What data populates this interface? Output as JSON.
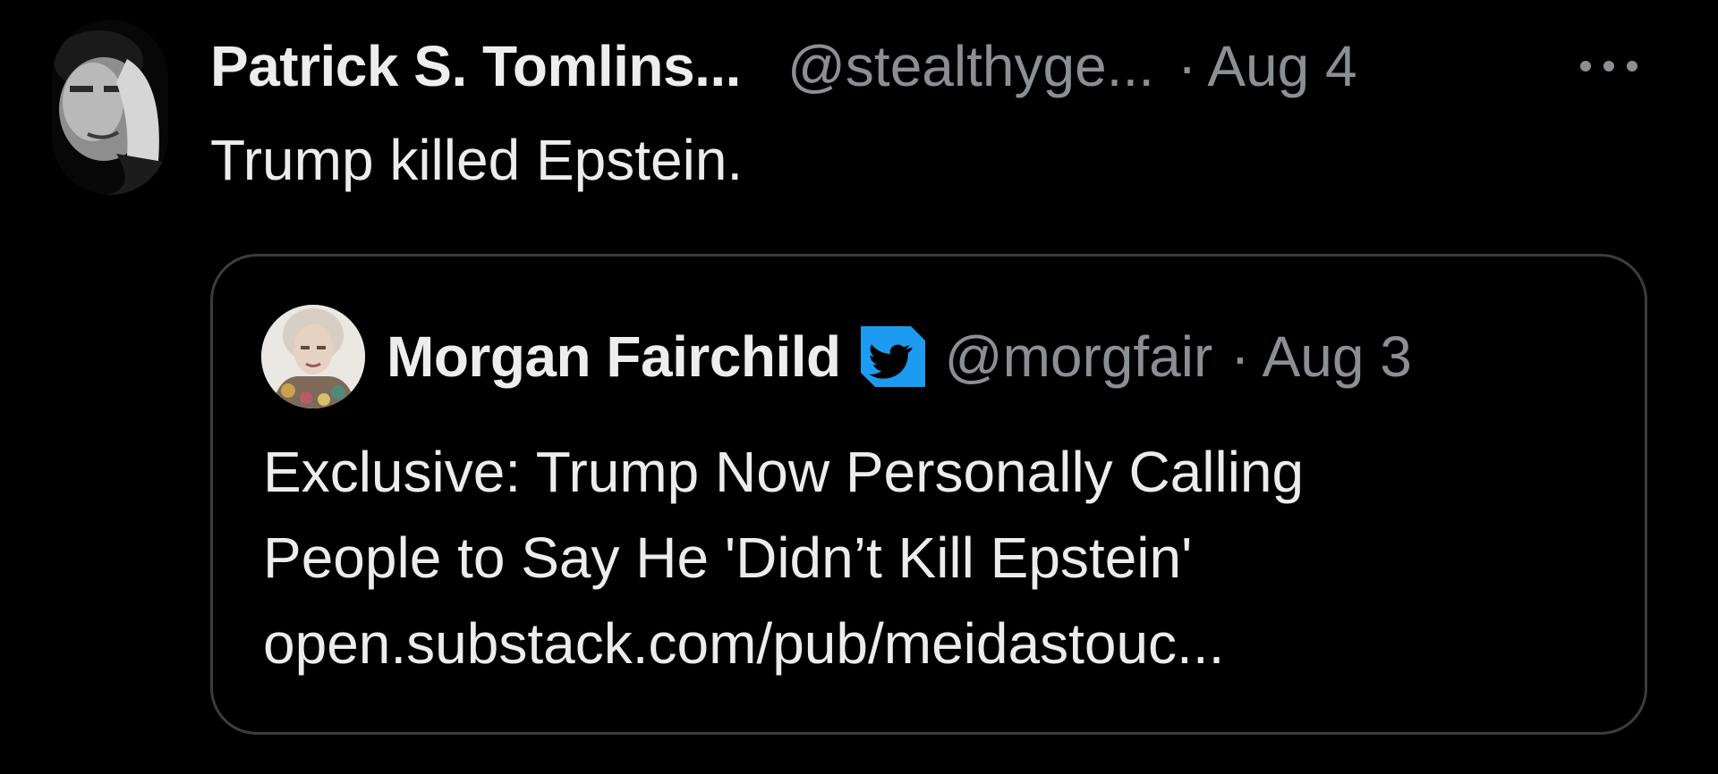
{
  "post": {
    "author_name": "Patrick S. Tomlins...",
    "author_handle": "@stealthyge...",
    "separator": "·",
    "date": "Aug 4",
    "more_icon": "more-horizontal-icon",
    "text": "Trump killed Epstein."
  },
  "quote": {
    "author_name": "Morgan Fairchild",
    "verified_icon": "verified-bird-badge-icon",
    "author_handle": "@morgfair",
    "separator": "·",
    "date": "Aug 3",
    "lines": [
      "Exclusive: Trump Now Personally Calling",
      "People to Say He 'Didn’t Kill Epstein'"
    ],
    "link": "open.substack.com/pub/meidastouc..."
  },
  "colors": {
    "background": "#000000",
    "text_primary": "#ececec",
    "text_secondary": "#8b8f93",
    "card_border": "#3a3d40",
    "badge_blue": "#1d9bf0"
  }
}
